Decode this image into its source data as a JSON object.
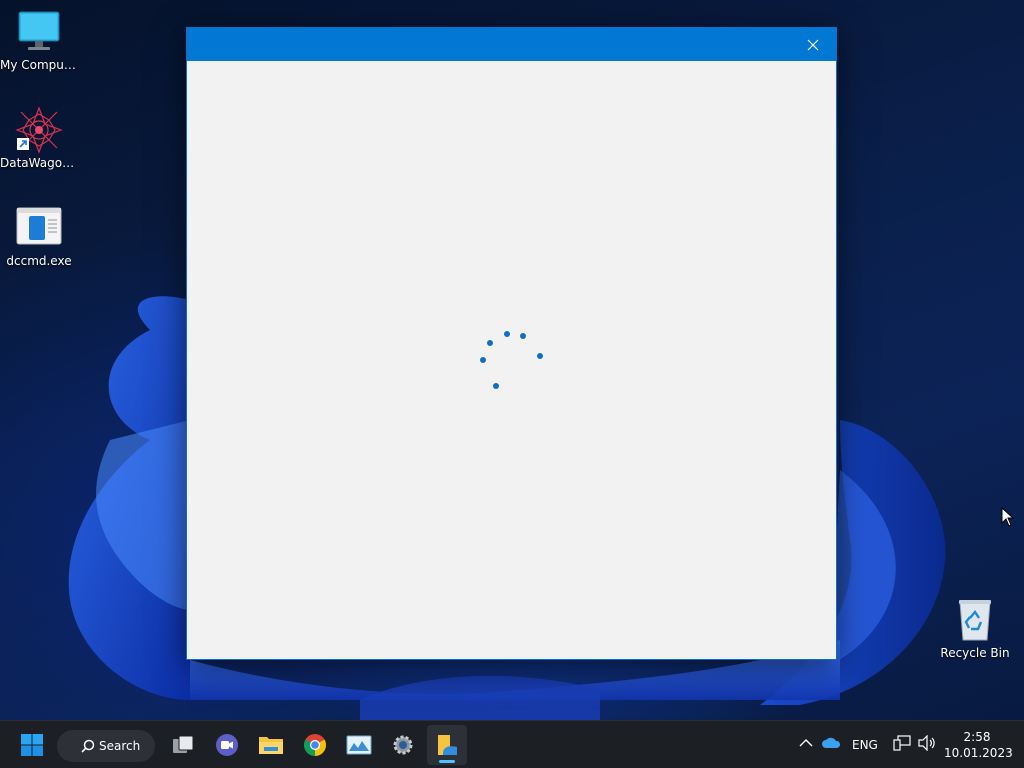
{
  "desktop": {
    "icons": [
      {
        "label": "My Computer",
        "icon": "monitor-icon"
      },
      {
        "label": "DataWagon...",
        "icon": "datawagon-shortcut-icon"
      },
      {
        "label": "dccmd.exe",
        "icon": "exe-file-icon"
      },
      {
        "label": "Recycle Bin",
        "icon": "recycle-bin-icon"
      }
    ]
  },
  "window": {
    "title": "",
    "state": "loading",
    "close_icon": "close-icon",
    "accent": "#0078d4",
    "body_bg": "#f2f2f2"
  },
  "taskbar": {
    "search_label": "Search",
    "apps": [
      {
        "icon": "start-icon",
        "label": "Start"
      },
      {
        "icon": "task-view-icon",
        "label": "Task View"
      },
      {
        "icon": "teams-chat-icon",
        "label": "Chat"
      },
      {
        "icon": "file-explorer-icon",
        "label": "File Explorer"
      },
      {
        "icon": "chrome-icon",
        "label": "Google Chrome"
      },
      {
        "icon": "image-viewer-icon",
        "label": "Photos"
      },
      {
        "icon": "settings-gear-icon",
        "label": "Settings"
      },
      {
        "icon": "active-app-icon",
        "label": "Active app"
      }
    ],
    "tray": {
      "language": "ENG",
      "time": "2:58",
      "date": "10.01.2023"
    }
  }
}
